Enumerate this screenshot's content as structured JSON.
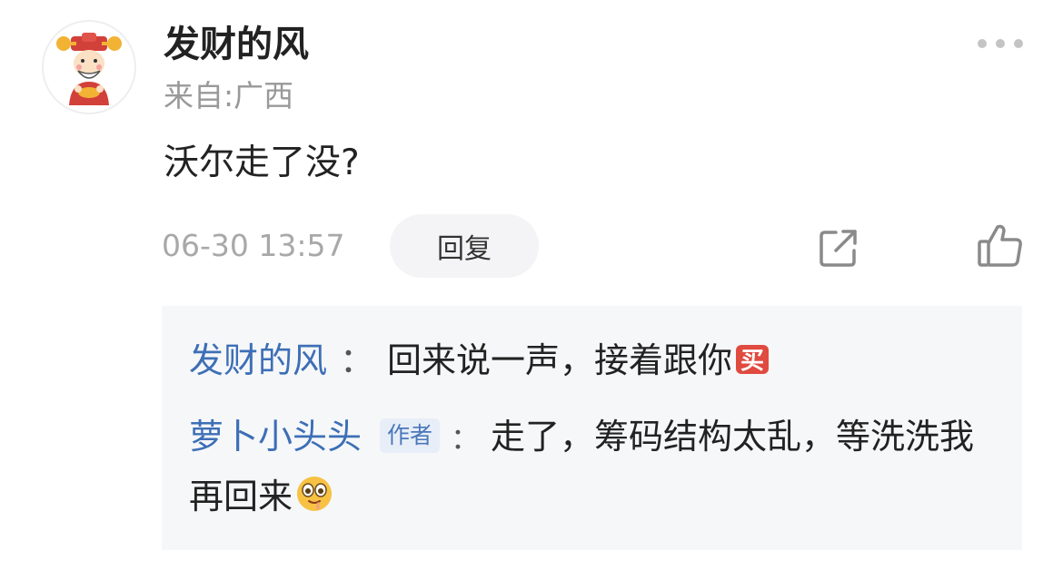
{
  "comment": {
    "author": "发财的风",
    "location": "来自:广西",
    "text": "沃尔走了没?",
    "timestamp": "06-30 13:57",
    "reply_label": "回复"
  },
  "replies": [
    {
      "name": "发财的风",
      "separator": "：",
      "text": "回来说一声，接着跟你",
      "emoji": "buy-emoji",
      "emoji_text": "买"
    },
    {
      "name": "萝卜小头头",
      "badge": "作者",
      "separator": "：",
      "text": "走了，筹码结构太乱，等洗洗我再回来",
      "emoji": "drooling-face-emoji"
    }
  ],
  "colors": {
    "name_blue": "#3d6fb6",
    "meta_gray": "#999999",
    "reply_bg": "#f6f7f9"
  },
  "icons": [
    "avatar-caishen",
    "more-icon",
    "share-icon",
    "like-icon"
  ]
}
